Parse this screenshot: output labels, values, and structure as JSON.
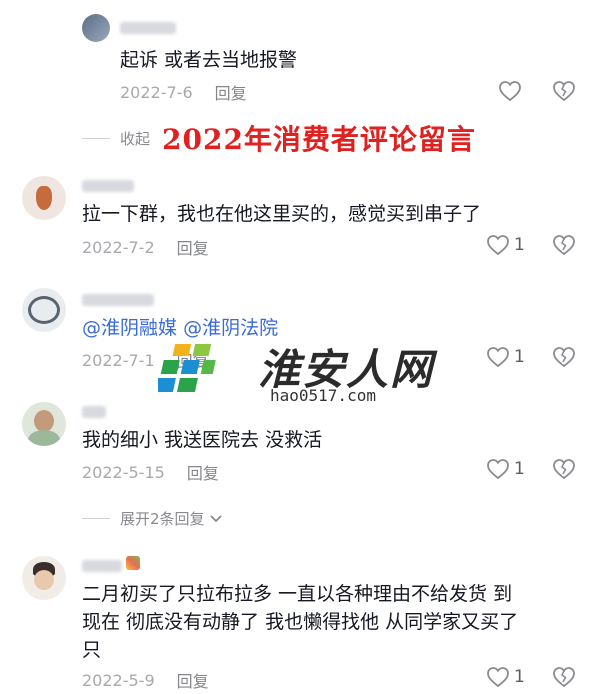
{
  "annotation": "2022年消费者评论留言",
  "watermark": {
    "site_cn": "淮安人网",
    "site_url": "hao0517.com"
  },
  "comments": [
    {
      "text": "起诉 或者去当地报警",
      "date": "2022-7-6",
      "reply_label": "回复",
      "likes": ""
    },
    {
      "text": "拉一下群，我也在他这里买的，感觉买到串子了",
      "date": "2022-7-2",
      "reply_label": "回复",
      "likes": "1"
    },
    {
      "mention1": "@淮阴融媒",
      "mention2": "@淮阴法院",
      "date": "2022-7-1",
      "reply_label": "回复",
      "likes": "1"
    },
    {
      "text": "我的细小 我送医院去 没救活",
      "date": "2022-5-15",
      "reply_label": "回复",
      "likes": "1"
    },
    {
      "line1": "二月初买了只拉布拉多 一直以各种理由不给发货 到",
      "line2": "现在 彻底没有动静了 我也懒得找他 从同学家又买了",
      "line3": "只",
      "date": "2022-5-9",
      "reply_label": "回复",
      "likes": "1"
    }
  ],
  "collapse_label": "收起",
  "expand_label": "展开2条回复",
  "icons": [
    "heart-icon",
    "broken-heart-icon",
    "chevron-down-icon"
  ]
}
